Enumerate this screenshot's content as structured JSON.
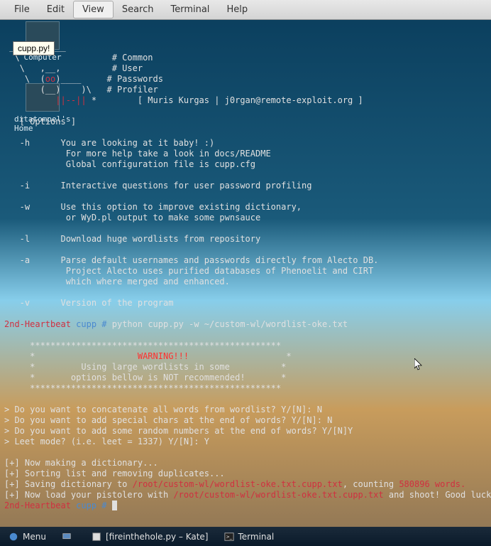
{
  "menubar": {
    "items": [
      {
        "label": "File"
      },
      {
        "label": "Edit"
      },
      {
        "label": "View"
      },
      {
        "label": "Search"
      },
      {
        "label": "Terminal"
      },
      {
        "label": "Help"
      }
    ]
  },
  "tooltip": "cupp.py!",
  "desktop": {
    "icons": [
      {
        "label": "Computer"
      },
      {
        "label": "ditatompel's Home"
      }
    ]
  },
  "terminal": {
    "ascii": {
      "l1": " ___________ ",
      "l2": "  \\                  ",
      "l3": "   \\   ,__,          ",
      "l4": "    \\  (",
      "l4oo": "oo",
      "l4b": ")____     ",
      "l5a": "       (__)    )\\   ",
      "l6a": "        ",
      "l6b": "  ||--||",
      "l6c": " *   ",
      "c": "# Common",
      "u": "# User",
      "p": "# Passwords",
      "pr": "# Profiler",
      "author": "     [ Muris Kurgas | j0rgan@remote-exploit.org ]"
    },
    "options_header": "   [ Options ]",
    "opts": {
      "h1": "   -h      You are looking at it baby! :)",
      "h2": "            For more help take a look in docs/README",
      "h3": "            Global configuration file is cupp.cfg",
      "i": "   -i      Interactive questions for user password profiling",
      "w1": "   -w      Use this option to improve existing dictionary,",
      "w2": "            or WyD.pl output to make some pwnsauce",
      "l": "   -l      Download huge wordlists from repository",
      "a1": "   -a      Parse default usernames and passwords directly from Alecto DB.",
      "a2": "            Project Alecto uses purified databases of Phenoelit and CIRT",
      "a3": "            which where merged and enhanced.",
      "v": "   -v      Version of the program"
    },
    "prompt1": {
      "host": "2nd-Heartbeat",
      "path": "cupp #",
      "cmd": "python cupp.py -w ~/custom-wl/wordlist-oke.txt"
    },
    "warning": {
      "stars": "     *************************************************",
      "l1a": "     *                    ",
      "l1b": "WARNING!!!",
      "l1c": "                   *",
      "l2": "     *         Using large wordlists in some          *",
      "l3": "     *       options bellow is NOT recommended!       *"
    },
    "questions": {
      "q1": "> Do you want to concatenate all words from wordlist? Y/[N]: N",
      "q2": "> Do you want to add special chars at the end of words? Y/[N]: N",
      "q3": "> Do you want to add some random numbers at the end of words? Y/[N]Y",
      "q4": "> Leet mode? (i.e. leet = 1337) Y/[N]: Y"
    },
    "output": {
      "l1": "[+] Now making a dictionary...",
      "l2": "[+] Sorting list and removing duplicates...",
      "l3a": "[+] Saving dictionary to ",
      "l3b": "/root/custom-wl/wordlist-oke.txt.cupp.txt",
      "l3c": ", counting ",
      "l3d": "580896 words.",
      "l4a": "[+] Now load your pistolero with ",
      "l4b": "/root/custom-wl/wordlist-oke.txt.cupp.txt",
      "l4c": " and shoot! Good luck!"
    },
    "prompt2": {
      "host": "2nd-Heartbeat",
      "path": "cupp #",
      "cursor": "▮"
    }
  },
  "taskbar": {
    "menu": "Menu",
    "app1": "[fireinthehole.py – Kate]",
    "app2": "Terminal"
  }
}
